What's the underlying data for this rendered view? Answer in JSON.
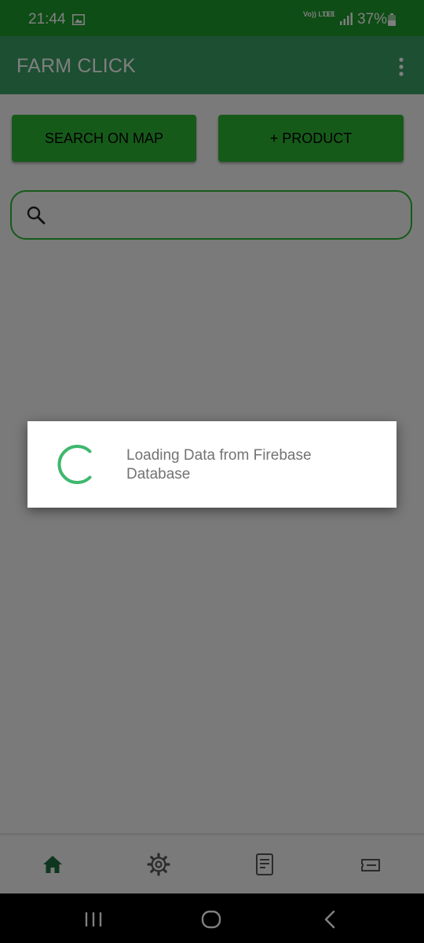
{
  "status_bar": {
    "time": "21:44",
    "volte": "Vo)) LTE1",
    "lte": "LTE",
    "battery": "37%",
    "icons": [
      "image-icon",
      "signal-icon",
      "battery-icon"
    ]
  },
  "app_bar": {
    "title": "FARM CLICK",
    "menu_icon": "more-vert-icon"
  },
  "actions": {
    "search_map": "SEARCH ON MAP",
    "add_product": "+ PRODUCT"
  },
  "search": {
    "value": "",
    "icon": "search-icon"
  },
  "dialog": {
    "message": "Loading Data from Firebase Database"
  },
  "bottom_nav": {
    "items": [
      "home-icon",
      "settings-icon",
      "orders-icon",
      "ticket-icon"
    ],
    "active": "home-icon"
  },
  "system_nav": [
    "recents-icon",
    "home-circle-icon",
    "back-icon"
  ],
  "colors": {
    "status_bar": "#1d9b2a",
    "app_bar": "#3b9f64",
    "accent": "#2db534",
    "spinner": "#3eb86e"
  }
}
